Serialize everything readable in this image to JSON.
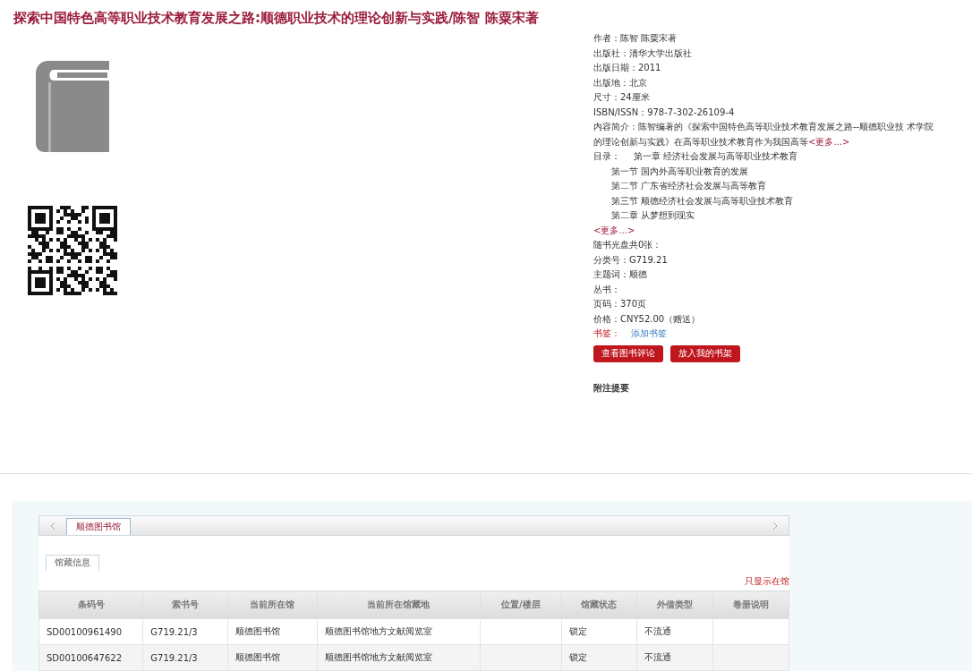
{
  "title": "探索中国特色高等职业技术教育发展之路:顺德职业技术的理论创新与实践/陈智 陈粟宋著",
  "info_fields": [
    {
      "label": "作者：",
      "value": "陈智 陈粟宋著"
    },
    {
      "label": "出版社：",
      "value": "清华大学出版社"
    },
    {
      "label": "出版日期：",
      "value": "2011"
    },
    {
      "label": "出版地：",
      "value": "北京"
    },
    {
      "label": "尺寸：",
      "value": "24厘米"
    },
    {
      "label": "ISBN/ISSN：",
      "value": "978-7-302-26109-4"
    }
  ],
  "summary": {
    "label": "内容简介：",
    "text": "陈智编著的《探索中国特色高等职业技术教育发展之路--顺德职业技 术学院的理论创新与实践》在高等职业技术教育作为我国高等",
    "more": "<更多...>"
  },
  "contents": {
    "label": "目录：",
    "entries": [
      {
        "text": "第一章 经济社会发展与高等职业技术教育",
        "children": [
          {
            "text": "第一节 国内外高等职业教育的发展"
          },
          {
            "text": "第二节 广东省经济社会发展与高等教育"
          },
          {
            "text": "第三节 顺德经济社会发展与高等职业技术教育"
          }
        ]
      },
      {
        "text": "第二章 从梦想到现实"
      }
    ],
    "more": "<更多...>"
  },
  "more_fields": [
    {
      "label": "随书光盘共0张："
    },
    {
      "label": "分类号：",
      "value": "G719.21"
    },
    {
      "label": "主题词：",
      "value": "顺德"
    },
    {
      "label": "丛书："
    },
    {
      "label": "页码：",
      "value": "370页"
    },
    {
      "label": "价格：",
      "value": "CNY52.00（赠送）"
    }
  ],
  "bookmark": {
    "label": "书签：",
    "link": "添加书签"
  },
  "buttons": [
    "查看图书评论",
    "放入我的书架"
  ],
  "notes_heading": "附注提要",
  "holdings": {
    "library_tabs": [
      {
        "label": "顺德图书馆",
        "selected": true
      }
    ],
    "sub_tabs": [
      {
        "label": "馆藏信息",
        "selected": true
      }
    ],
    "filter_link": "只显示在馆",
    "columns": [
      "条码号",
      "索书号",
      "当前所在馆",
      "当前所在馆藏地",
      "位置/楼层",
      "馆藏状态",
      "外借类型",
      "卷册说明"
    ],
    "rows": [
      [
        "SD00100961490",
        "G719.21/3",
        "顺德图书馆",
        "顺德图书馆地方文献阅览室",
        "",
        "锁定",
        "不流通",
        ""
      ],
      [
        "SD00100647622",
        "G719.21/3",
        "顺德图书馆",
        "顺德图书馆地方文献阅览室",
        "",
        "锁定",
        "不流通",
        ""
      ]
    ]
  }
}
